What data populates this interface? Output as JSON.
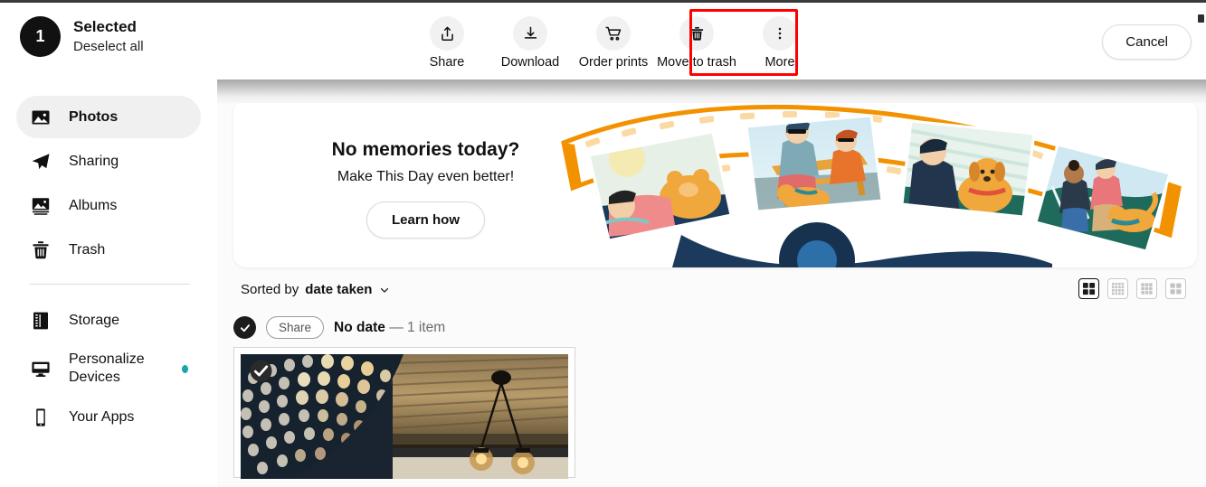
{
  "topbar": {
    "badge_count": "1",
    "selected_label": "Selected",
    "deselect_label": "Deselect all",
    "cancel_label": "Cancel",
    "actions": [
      {
        "label": "Share",
        "icon": "share-upload-icon",
        "highlighted": false
      },
      {
        "label": "Download",
        "icon": "download-icon",
        "highlighted": false
      },
      {
        "label": "Order prints",
        "icon": "shopping-cart-icon",
        "highlighted": false
      },
      {
        "label": "Move to trash",
        "icon": "trash-icon",
        "highlighted": true
      },
      {
        "label": "More",
        "icon": "more-vertical-icon",
        "highlighted": false
      }
    ],
    "highlight_color": "#ff0000"
  },
  "sidebar": {
    "items": [
      {
        "label": "Photos",
        "icon": "photo-icon",
        "active": true,
        "dot": false
      },
      {
        "label": "Sharing",
        "icon": "paper-plane-icon",
        "active": false,
        "dot": false
      },
      {
        "label": "Albums",
        "icon": "albums-icon",
        "active": false,
        "dot": false
      },
      {
        "label": "Trash",
        "icon": "trash-icon",
        "active": false,
        "dot": false
      }
    ],
    "items_lower": [
      {
        "label": "Storage",
        "icon": "storage-icon",
        "active": false,
        "dot": false
      },
      {
        "label": "Personalize Devices",
        "icon": "monitor-icon",
        "active": false,
        "dot": true
      },
      {
        "label": "Your Apps",
        "icon": "phone-icon",
        "active": false,
        "dot": false
      }
    ],
    "dot_color": "#1ba5a8"
  },
  "memories": {
    "title": "No memories today?",
    "subtitle": "Make This Day even better!",
    "button_label": "Learn how",
    "art_description": "orange film strip with illustrated photos"
  },
  "sortbar": {
    "prefix": "Sorted by",
    "value": "date taken",
    "chevron": "chevron-down-icon",
    "views": [
      {
        "name": "view-mixed",
        "active": true
      },
      {
        "name": "view-dense-grid",
        "active": false
      },
      {
        "name": "view-medium-grid",
        "active": false
      },
      {
        "name": "view-large-grid",
        "active": false
      }
    ]
  },
  "date_group": {
    "share_label": "Share",
    "date_label": "No date",
    "separator": "—",
    "count_label": "1 item",
    "selected": true
  },
  "photo": {
    "selected": true,
    "description": "ceiling with perforated panel and hanging pendant lights"
  }
}
